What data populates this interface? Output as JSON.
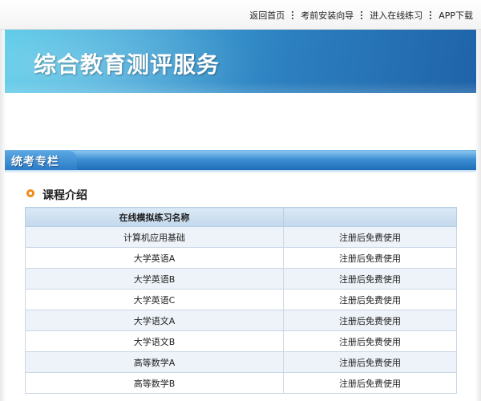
{
  "topnav": {
    "items": [
      "返回首页",
      "考前安装向导",
      "进入在线练习",
      "APP下载"
    ]
  },
  "banner": {
    "title": "综合教育测评服务"
  },
  "section": {
    "title": "统考专栏"
  },
  "intro": {
    "heading": "课程介绍"
  },
  "table": {
    "headers": [
      "在线模拟练习名称",
      ""
    ],
    "rows": [
      {
        "name": "计算机应用基础",
        "note": "注册后免费使用"
      },
      {
        "name": "大学英语A",
        "note": "注册后免费使用"
      },
      {
        "name": "大学英语B",
        "note": "注册后免费使用"
      },
      {
        "name": "大学英语C",
        "note": "注册后免费使用"
      },
      {
        "name": "大学语文A",
        "note": "注册后免费使用"
      },
      {
        "name": "大学语文B",
        "note": "注册后免费使用"
      },
      {
        "name": "高等数学A",
        "note": "注册后免费使用"
      },
      {
        "name": "高等数学B",
        "note": "注册后免费使用"
      }
    ]
  },
  "colors": {
    "accent_orange": "#f18b17",
    "banner_blue": "#2c7fbf",
    "bar_blue": "#1f6db9"
  }
}
